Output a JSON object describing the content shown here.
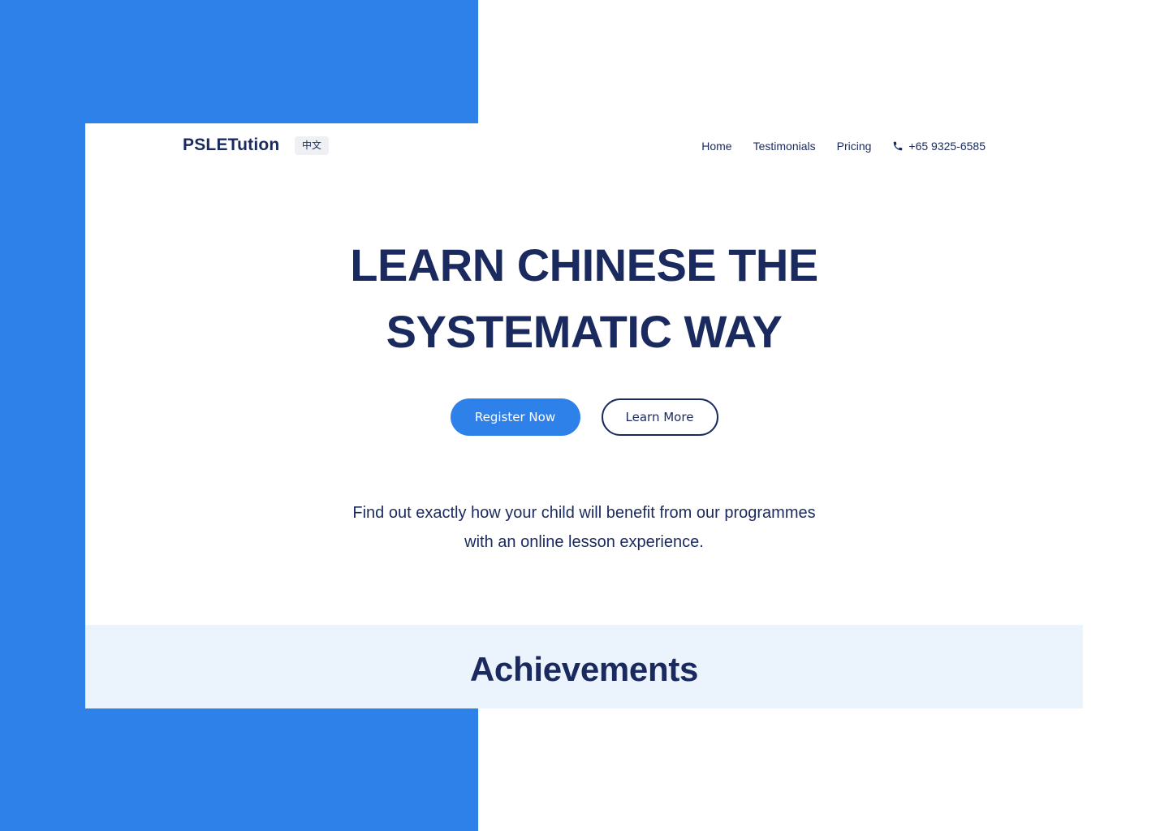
{
  "colors": {
    "accent_blue": "#2f81ea",
    "navy_text": "#1a2a5e",
    "section_bg": "#ebf3fd",
    "badge_bg": "#eef0f4"
  },
  "nav": {
    "logo": "PSLETution",
    "language_toggle": "中文",
    "links": [
      "Home",
      "Testimonials",
      "Pricing"
    ],
    "phone": {
      "icon": "phone-icon",
      "number": "+65 9325-6585"
    }
  },
  "hero": {
    "title_lines": [
      "LEARN CHINESE THE",
      "SYSTEMATIC WAY"
    ],
    "primary_button": "Register Now",
    "secondary_button": "Learn More",
    "subtext_lines": [
      "Find out exactly how your child will benefit from our programmes",
      "with an online lesson experience."
    ]
  },
  "achievements": {
    "heading": "Achievements"
  }
}
